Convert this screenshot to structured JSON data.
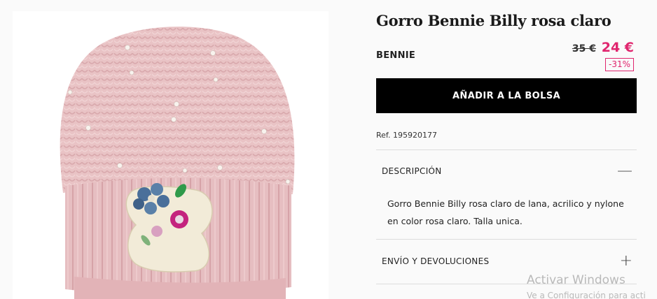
{
  "product": {
    "title": "Gorro Bennie Billy rosa claro",
    "category": "BENNIE",
    "old_price": "35 €",
    "new_price": "24 €",
    "discount": "-31%",
    "add_to_bag_label": "AÑADIR A LA BOLSA",
    "reference": "Ref. 195920177",
    "image_icon": "beanie-product-photo"
  },
  "accordion": {
    "description": {
      "label": "DESCRIPCIÓN",
      "icon": "minus-icon",
      "toggle_symbol": "—",
      "lines": [
        "Gorro Bennie Billy rosa claro de lana, acrilico y nylone",
        "en color rosa claro. Talla unica."
      ]
    },
    "shipping": {
      "label": "ENVÍO Y DEVOLUCIONES",
      "icon": "plus-icon",
      "toggle_symbol": "+"
    }
  },
  "os_watermark": {
    "title": "Activar Windows",
    "subtitle": "Ve a Configuración para acti"
  },
  "colors": {
    "sale_pink": "#e0256e",
    "button_black": "#000000",
    "beanie_pink": "#e8c4c6"
  }
}
